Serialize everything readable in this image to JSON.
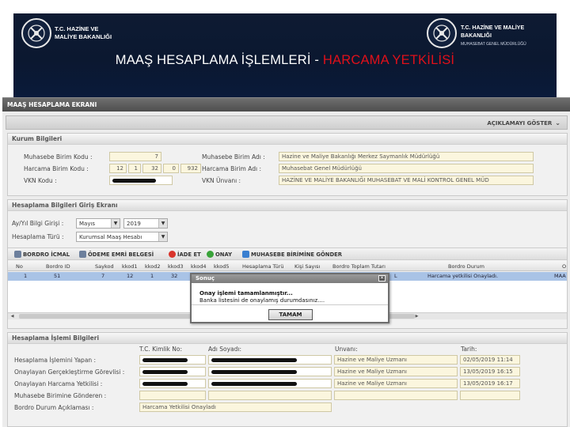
{
  "slide": {
    "logo_left_line1": "T.C. HAZİNE VE",
    "logo_left_line2": "MALİYE BAKANLIĞI",
    "logo_right_line1": "T.C. HAZİNE VE MALİYE BAKANLIĞI",
    "logo_right_line2": "MUHASEBAT GENEL MÜDÜRLÜĞÜ",
    "title_main": "MAAŞ HESAPLAMA İŞLEMLERİ - ",
    "title_accent": "HARCAMA YETKİLİSİ",
    "accent_color": "#e0101a"
  },
  "app": {
    "window_title": "MAAŞ HESAPLAMA EKRANI",
    "aciklama_label": "AÇIKLAMAYI GÖSTER",
    "kurum": {
      "title": "Kurum Bilgileri",
      "muhasebe_kodu_label": "Muhasebe Birim Kodu  :",
      "muhasebe_kodu_value": "7",
      "harcama_kodu_label": "Harcama Birim Kodu  :",
      "harcama_kodu_parts": [
        "12",
        "1",
        "32",
        "0",
        "932"
      ],
      "vkn_kodu_label": "VKN Kodu  :",
      "muhasebe_adi_label": "Muhasebe Birim Adı  :",
      "muhasebe_adi_value": "Hazine ve Maliye Bakanlığı Merkez Saymanlık Müdürlüğü",
      "harcama_adi_label": "Harcama Birim Adı  :",
      "harcama_adi_value": "Muhasebat Genel Müdürlüğü",
      "vkn_unvani_label": "VKN Ünvanı  :",
      "vkn_unvani_value": "HAZİNE VE MALİYE BAKANLIĞI MUHASEBAT VE MALİ KONTROL GENEL MÜD"
    },
    "hesaplama": {
      "title": "Hesaplama Bilgileri Giriş Ekranı",
      "ay_yil_label": "Ay/Yıl Bilgi Girişi  :",
      "ay_value": "Mayıs",
      "yil_value": "2019",
      "turu_label": "Hesaplama Türü  :",
      "turu_value": "Kurumsal Maaş Hesabı",
      "toolbar": {
        "bordro_icmal": "BORDRO İCMAL",
        "odeme_emri": "ÖDEME EMRİ BELGESİ",
        "iade_et": "İADE ET",
        "onay": "ONAY",
        "muhasebe_gonder": "MUHASEBE BİRİMİNE GÖNDER"
      },
      "columns": [
        "No",
        "Bordro ID",
        "Saykod",
        "kkod1",
        "kkod2",
        "kkod3",
        "kkod4",
        "kkod5",
        "Hesaplama Türü",
        "Kişi Sayısı",
        "Bordro Toplam Tutarı",
        "Bordro Durum",
        "O"
      ],
      "row": {
        "no": "1",
        "bordro_id": "51",
        "saykod": "7",
        "kkod1": "12",
        "kkod2": "1",
        "kkod3": "32",
        "trail": "L",
        "durum": "Harcama yetkilisi Onayladı.",
        "o": "MAA"
      }
    },
    "dialog": {
      "title": "Sonuç",
      "message_line1": "Onay işlemi tamamlanmıştır...",
      "message_line2": "Banka listesini de onaylamış durumdasınız....",
      "button": "TAMAM"
    },
    "islem": {
      "title": "Hesaplama İşlemi Bilgileri",
      "col_tc": "T.C. Kimlik No:",
      "col_ad": "Adı Soyadı:",
      "col_unvan": "Unvanı:",
      "col_tarih": "Tarih:",
      "rows": [
        {
          "label": "Hesaplama İşlemini Yapan :",
          "unvan": "Hazine ve Maliye Uzmanı",
          "tarih": "02/05/2019 11:14"
        },
        {
          "label": "Onaylayan Gerçekleştirme Görevlisi :",
          "unvan": "Hazine ve Maliye Uzmanı",
          "tarih": "13/05/2019 16:15"
        },
        {
          "label": "Onaylayan Harcama Yetkilisi :",
          "unvan": "Hazine ve Maliye Uzmanı",
          "tarih": "13/05/2019 16:17"
        },
        {
          "label": "Muhasebe Birimine Gönderen :",
          "unvan": "",
          "tarih": ""
        }
      ],
      "aciklama_label": "Bordro Durum Açıklaması :",
      "aciklama_value": "Harcama Yetkilisi Onayladı"
    }
  }
}
